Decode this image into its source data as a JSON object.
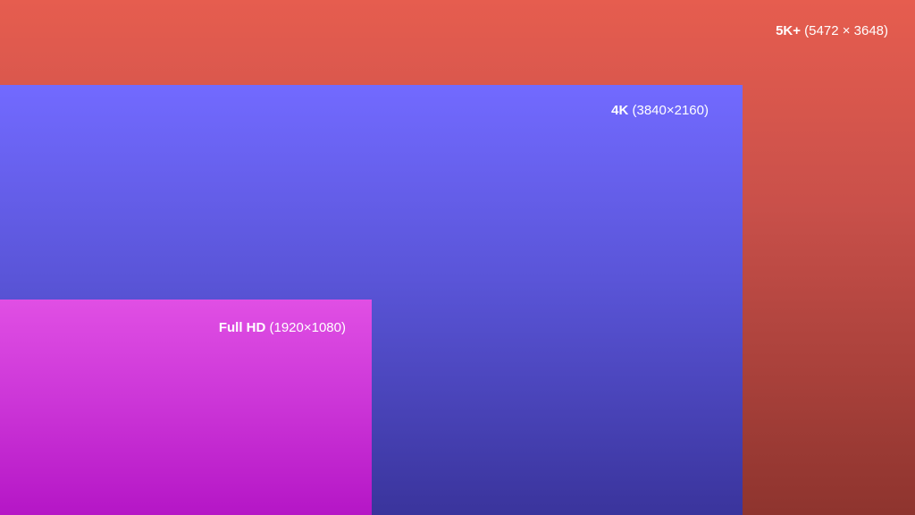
{
  "resolutions": [
    {
      "name": "5K+",
      "dims": "(5472 × 3648)",
      "color": "#e65d4f"
    },
    {
      "name": "4K",
      "dims": "(3840×2160)",
      "color": "#726aff"
    },
    {
      "name": "Full HD",
      "dims": "(1920×1080)",
      "color": "#e04fe4"
    }
  ]
}
